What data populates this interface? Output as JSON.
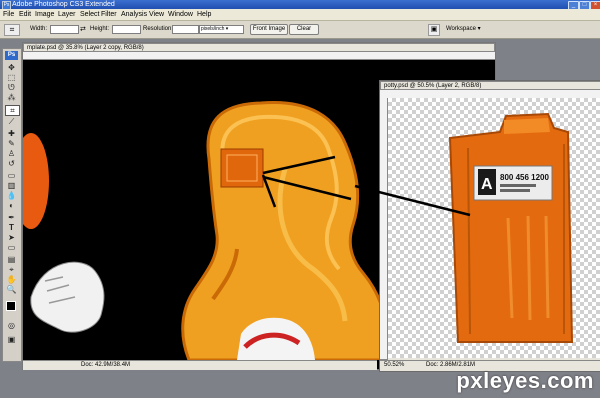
{
  "app": {
    "title": "Adobe Photoshop CS3 Extended",
    "logo": "Ps"
  },
  "menu": [
    "File",
    "Edit",
    "Image",
    "Layer",
    "Select",
    "Filter",
    "Analysis",
    "View",
    "Window",
    "Help"
  ],
  "options_bar": {
    "width_label": "Width:",
    "height_label": "Height:",
    "resolution_label": "Resolution:",
    "resolution_unit": "pixels/inch",
    "front_image_label": "Front Image",
    "clear_label": "Clear",
    "workspace_label": "Workspace ▾"
  },
  "tools": {
    "logo": "Ps",
    "icons": [
      "move-icon",
      "marquee-icon",
      "lasso-icon",
      "magic-wand-icon",
      "crop-icon",
      "slice-icon",
      "healing-brush-icon",
      "brush-icon",
      "clone-stamp-icon",
      "history-brush-icon",
      "eraser-icon",
      "gradient-icon",
      "blur-icon",
      "dodge-icon",
      "pen-icon",
      "type-icon",
      "path-selection-icon",
      "shape-icon",
      "notes-icon",
      "eyedropper-icon",
      "hand-icon",
      "zoom-icon"
    ]
  },
  "doc_left": {
    "title": "mplate.psd @ 35.8% (Layer 2 copy, RGB/8)",
    "zoom": "",
    "doc_size": "Doc: 42.9M/38.4M"
  },
  "doc_right": {
    "title": "potty.psd @ 50.5% (Layer 2, RGB/8)",
    "zoom": "50.52%",
    "doc_size": "Doc: 2.86M/2.81M"
  },
  "label_plate": {
    "letter": "A",
    "phone": "800 456 1200"
  },
  "watermark": "pxleyes.com",
  "colors": {
    "title_blue": "#1f4fb0",
    "canvas_black": "#000000",
    "potty_orange": "#e0670c",
    "seat_orange": "#f0a020"
  }
}
